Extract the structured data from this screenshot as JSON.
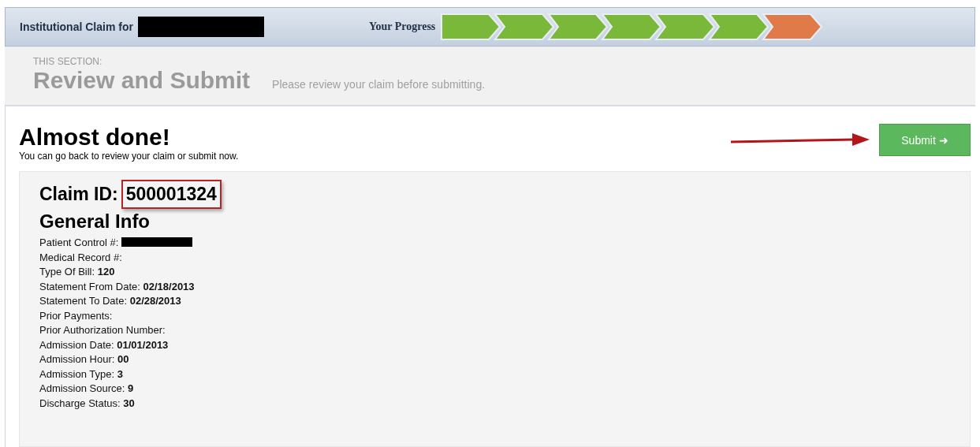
{
  "header": {
    "title": "Institutional Claim for",
    "title_redacted": true,
    "progress_label": "Your Progress",
    "progress_steps": [
      {
        "completed": true
      },
      {
        "completed": true
      },
      {
        "completed": true
      },
      {
        "completed": true
      },
      {
        "completed": true
      },
      {
        "completed": true
      },
      {
        "completed": false
      }
    ]
  },
  "section": {
    "caption": "THIS SECTION:",
    "title": "Review and Submit",
    "hint": "Please review your claim before submitting."
  },
  "main": {
    "heading": "Almost done!",
    "subtext": "You can go back to review your claim or submit now.",
    "submit_button": "Submit ➜",
    "claim_id_label": "Claim ID:",
    "claim_id": "500001324",
    "general_heading": "General Info",
    "fields": [
      {
        "label": "Patient Control #:",
        "redacted": true
      },
      {
        "label": "Medical Record #:"
      },
      {
        "label": "Type Of Bill:",
        "value": "120"
      },
      {
        "label": "Statement From Date:",
        "value": "02/18/2013"
      },
      {
        "label": "Statement To Date:",
        "value": "02/28/2013"
      },
      {
        "label": "Prior Payments:"
      },
      {
        "label": "Prior Authorization Number:"
      },
      {
        "label": "Admission Date:",
        "value": "01/01/2013"
      },
      {
        "label": "Admission Hour:",
        "value": "00"
      },
      {
        "label": "Admission Type:",
        "value": "3"
      },
      {
        "label": "Admission Source:",
        "value": "9"
      },
      {
        "label": "Discharge Status:",
        "value": "30"
      }
    ]
  }
}
